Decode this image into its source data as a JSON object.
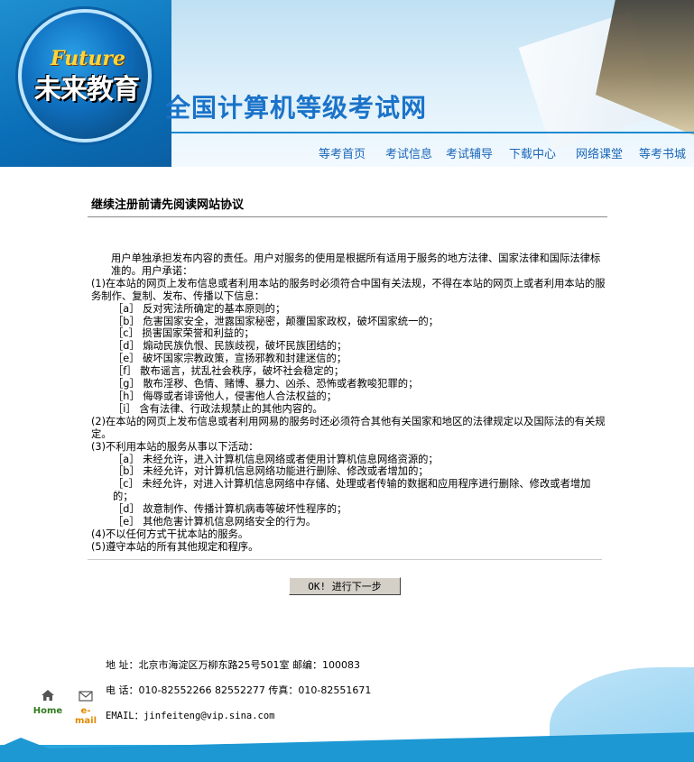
{
  "header": {
    "logo_en": "Future",
    "logo_cn": "未来教育",
    "site_title": "全国计算机等级考试网"
  },
  "nav": [
    "等考首页",
    "考试信息",
    "考试辅导",
    "下载中心",
    "网络课堂",
    "等考书城"
  ],
  "agreement": {
    "heading": "继续注册前请先阅读网站协议",
    "lines": [
      {
        "cls": "ind1",
        "text": "用户单独承担发布内容的责任。用户对服务的使用是根据所有适用于服务的地方法律、国家法律和国际法律标准的。用户承诺："
      },
      {
        "cls": "",
        "text": "(1)在本站的网页上发布信息或者利用本站的服务时必须符合中国有关法规，不得在本站的网页上或者利用本站的服务制作、复制、发布、传播以下信息："
      },
      {
        "cls": "ind2",
        "text": "［a］ 反对宪法所确定的基本原则的；"
      },
      {
        "cls": "ind2",
        "text": "［b］ 危害国家安全，泄露国家秘密，颠覆国家政权，破坏国家统一的；"
      },
      {
        "cls": "ind2",
        "text": "［c］ 损害国家荣誉和利益的；"
      },
      {
        "cls": "ind2",
        "text": "［d］ 煽动民族仇恨、民族歧视，破坏民族团结的；"
      },
      {
        "cls": "ind2",
        "text": "［e］ 破坏国家宗教政策，宣扬邪教和封建迷信的；"
      },
      {
        "cls": "ind2",
        "text": "［f］ 散布谣言，扰乱社会秩序，破坏社会稳定的；"
      },
      {
        "cls": "ind2",
        "text": "［g］ 散布淫秽、色情、赌博、暴力、凶杀、恐怖或者教唆犯罪的；"
      },
      {
        "cls": "ind2",
        "text": "［h］ 侮辱或者诽谤他人，侵害他人合法权益的；"
      },
      {
        "cls": "ind2",
        "text": "［i］ 含有法律、行政法规禁止的其他内容的。"
      },
      {
        "cls": "",
        "text": "(2)在本站的网页上发布信息或者利用网易的服务时还必须符合其他有关国家和地区的法律规定以及国际法的有关规定。"
      },
      {
        "cls": "",
        "text": "(3)不利用本站的服务从事以下活动："
      },
      {
        "cls": "ind2",
        "text": "［a］ 未经允许，进入计算机信息网络或者使用计算机信息网络资源的；"
      },
      {
        "cls": "ind2",
        "text": "［b］ 未经允许，对计算机信息网络功能进行删除、修改或者增加的；"
      },
      {
        "cls": "ind2",
        "text": "［c］ 未经允许，对进入计算机信息网络中存储、处理或者传输的数据和应用程序进行删除、修改或者增加的；"
      },
      {
        "cls": "ind2",
        "text": "［d］ 故意制作、传播计算机病毒等破坏性程序的；"
      },
      {
        "cls": "ind2",
        "text": "［e］ 其他危害计算机信息网络安全的行为。"
      },
      {
        "cls": "",
        "text": "(4)不以任何方式干扰本站的服务。"
      },
      {
        "cls": "",
        "text": "(5)遵守本站的所有其他规定和程序。"
      }
    ]
  },
  "ok_button": "OK! 进行下一步",
  "footer": {
    "address": "地 址：北京市海淀区万柳东路25号501室  邮编：100083",
    "phone": "电 话：010-82552266 82552277 传真：010-82551671",
    "email": "EMAIL：jinfeiteng@vip.sina.com",
    "home_label": "Home",
    "email_label": "e-mail"
  },
  "icons": {
    "home": "house-icon",
    "email": "envelope-icon"
  }
}
